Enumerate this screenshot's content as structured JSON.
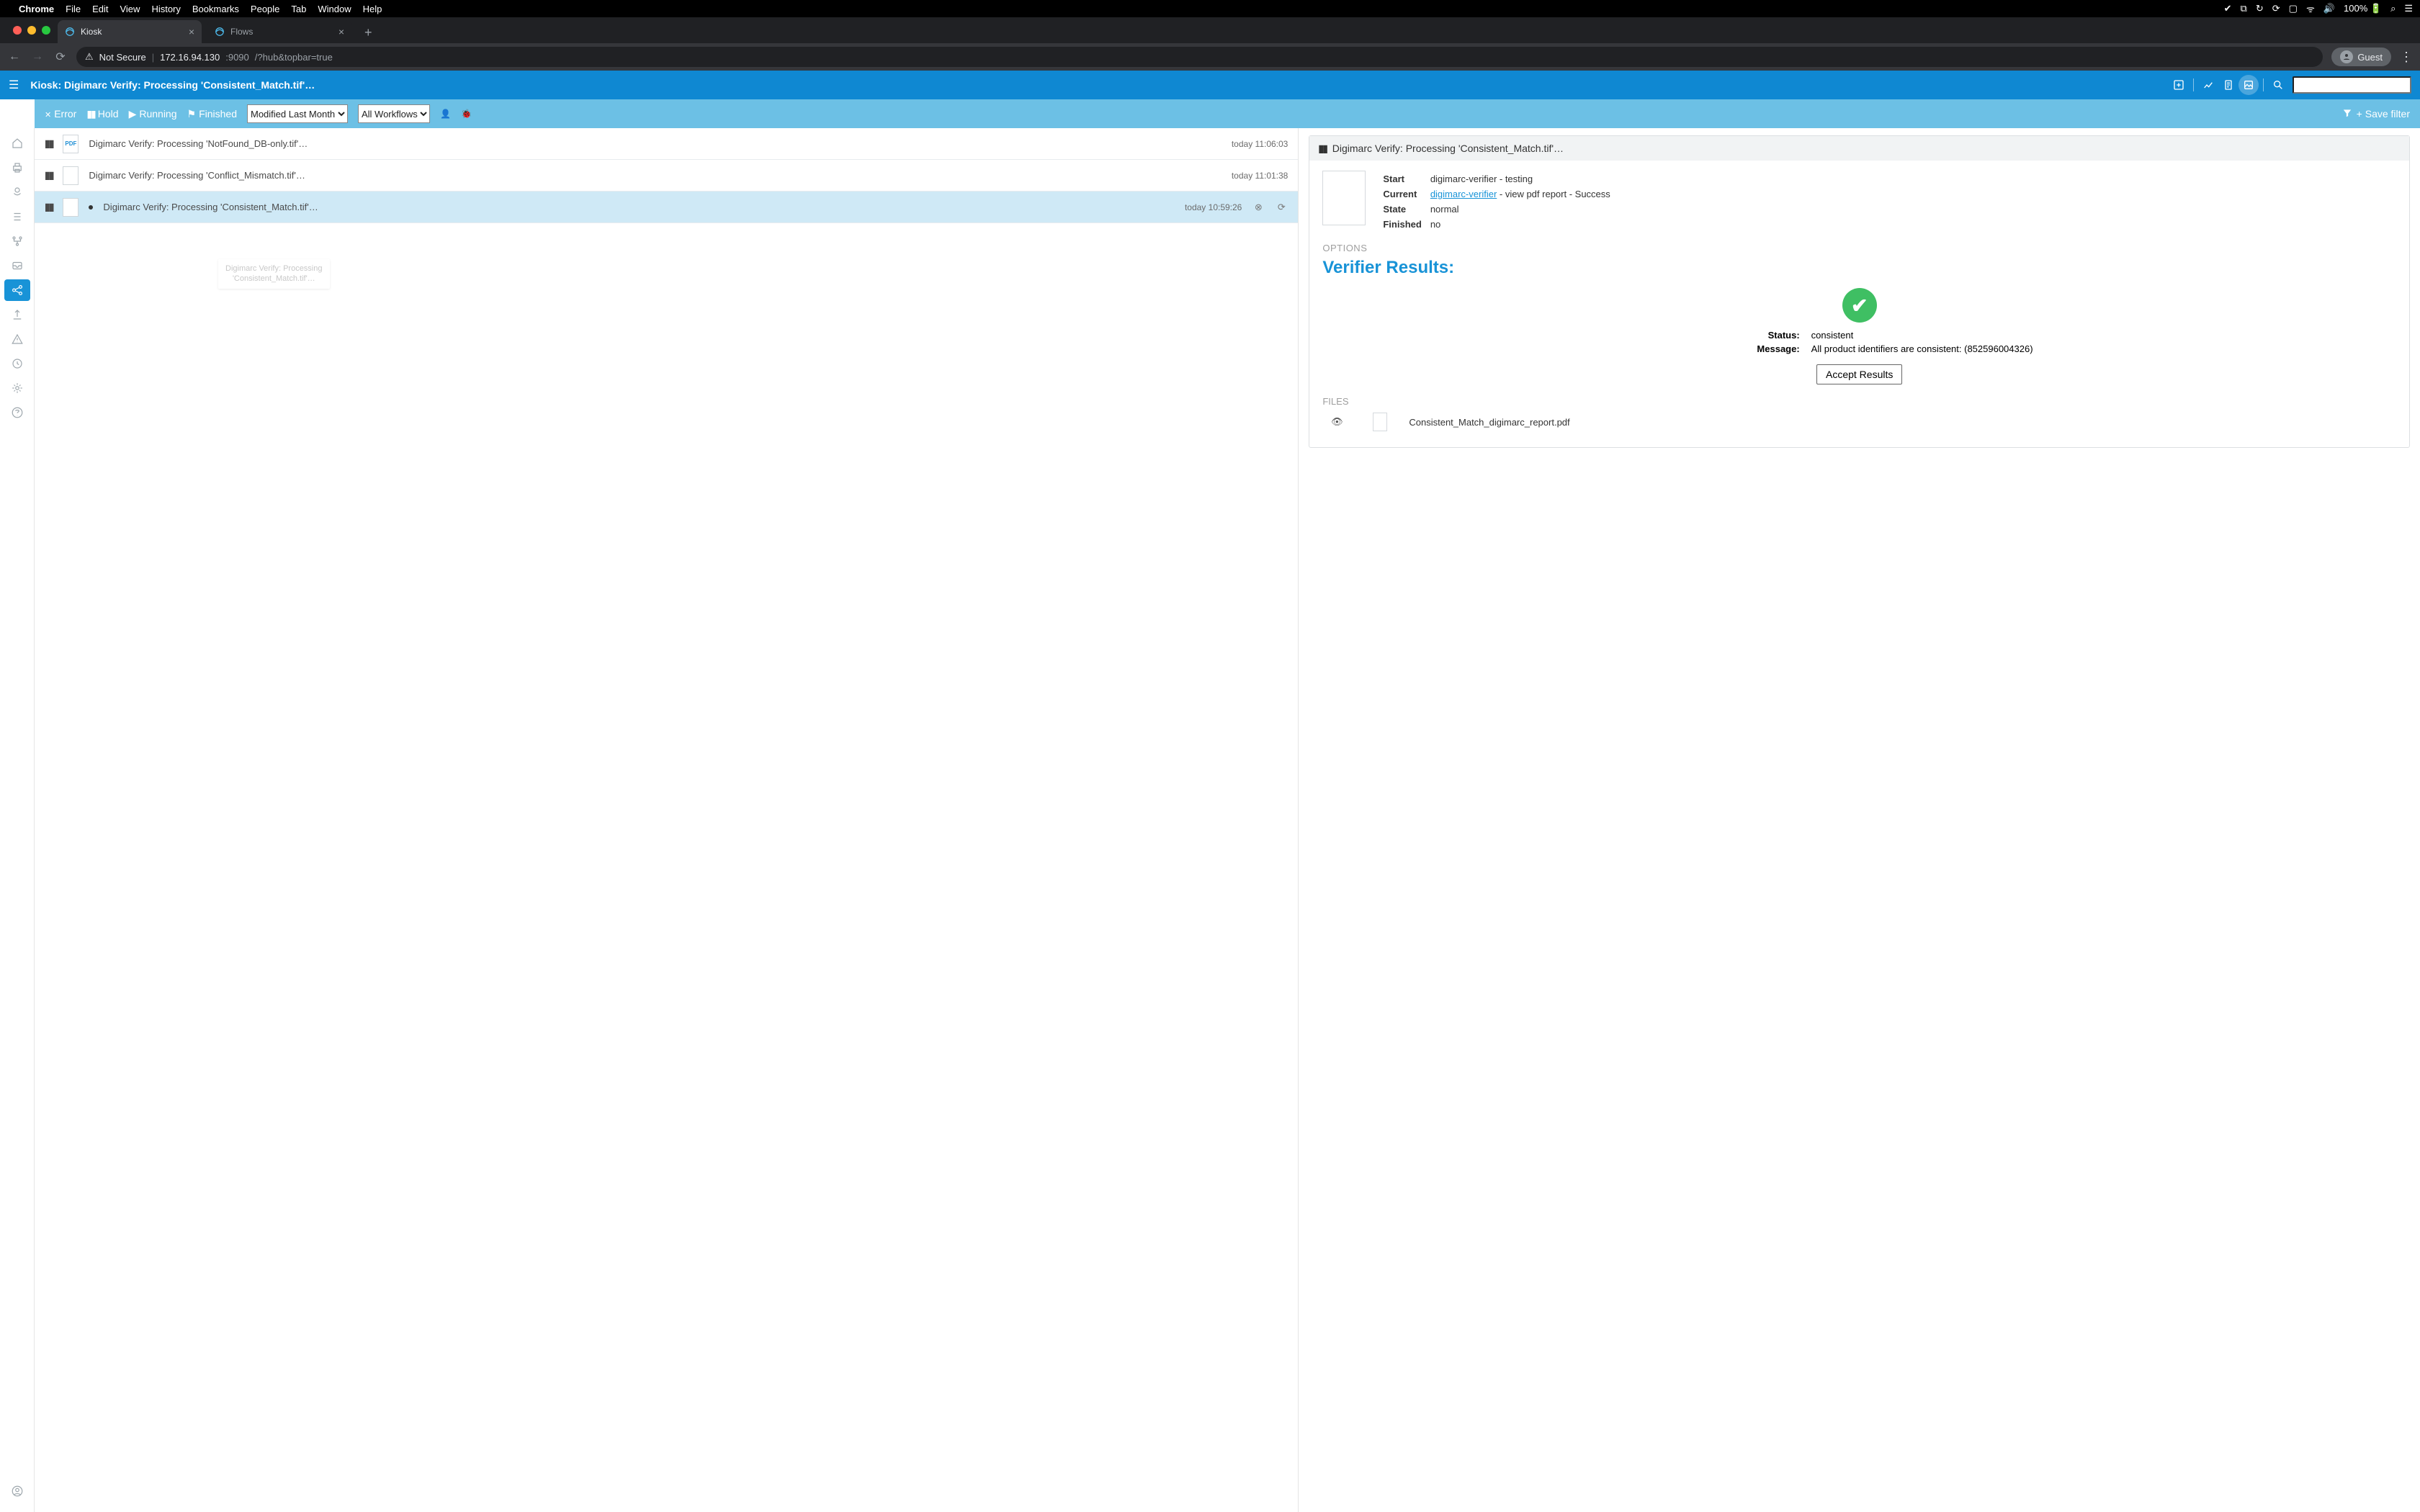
{
  "mac_menu": {
    "app": "Chrome",
    "items": [
      "File",
      "Edit",
      "View",
      "History",
      "Bookmarks",
      "People",
      "Tab",
      "Window",
      "Help"
    ],
    "battery": "100%"
  },
  "browser": {
    "tabs": [
      {
        "title": "Kiosk",
        "active": true
      },
      {
        "title": "Flows",
        "active": false
      }
    ],
    "not_secure": "Not Secure",
    "url_host": "172.16.94.130",
    "url_port": ":9090",
    "url_path": "/?hub&topbar=true",
    "guest": "Guest"
  },
  "header": {
    "title": "Kiosk:  Digimarc Verify: Processing 'Consistent_Match.tif'…"
  },
  "filterbar": {
    "error": "Error",
    "hold": "Hold",
    "running": "Running",
    "finished": "Finished",
    "select1_options": [
      "Modified Last Month"
    ],
    "select2_options": [
      "All Workflows"
    ],
    "save_filter": "+ Save filter"
  },
  "jobs": [
    {
      "name": "Digimarc Verify: Processing 'NotFound_DB-only.tif'…",
      "time": "today 11:06:03",
      "thumb": "pdf",
      "selected": false,
      "dot": false
    },
    {
      "name": "Digimarc Verify: Processing 'Conflict_Mismatch.tif'…",
      "time": "today 11:01:38",
      "thumb": "doc",
      "selected": false,
      "dot": false
    },
    {
      "name": "Digimarc Verify: Processing 'Consistent_Match.tif'…",
      "time": "today 10:59:26",
      "thumb": "doc",
      "selected": true,
      "dot": true
    }
  ],
  "tooltip": {
    "l1": "Digimarc Verify: Processing",
    "l2": "'Consistent_Match.tif'…"
  },
  "detail": {
    "header": "Digimarc Verify: Processing 'Consistent_Match.tif'…",
    "meta": {
      "start_k": "Start",
      "start_v": "digimarc-verifier - testing",
      "current_k": "Current",
      "current_link": "digimarc-verifier",
      "current_rest": " - view pdf report - Success",
      "state_k": "State",
      "state_v": "normal",
      "finished_k": "Finished",
      "finished_v": "no"
    },
    "options_label": "OPTIONS",
    "verifier_heading": "Verifier Results:",
    "status_k": "Status:",
    "status_v": "consistent",
    "message_k": "Message:",
    "message_v": "All product identifiers are consistent: (852596004326)",
    "accept": "Accept Results",
    "files_label": "FILES",
    "file_name": "Consistent_Match_digimarc_report.pdf"
  }
}
